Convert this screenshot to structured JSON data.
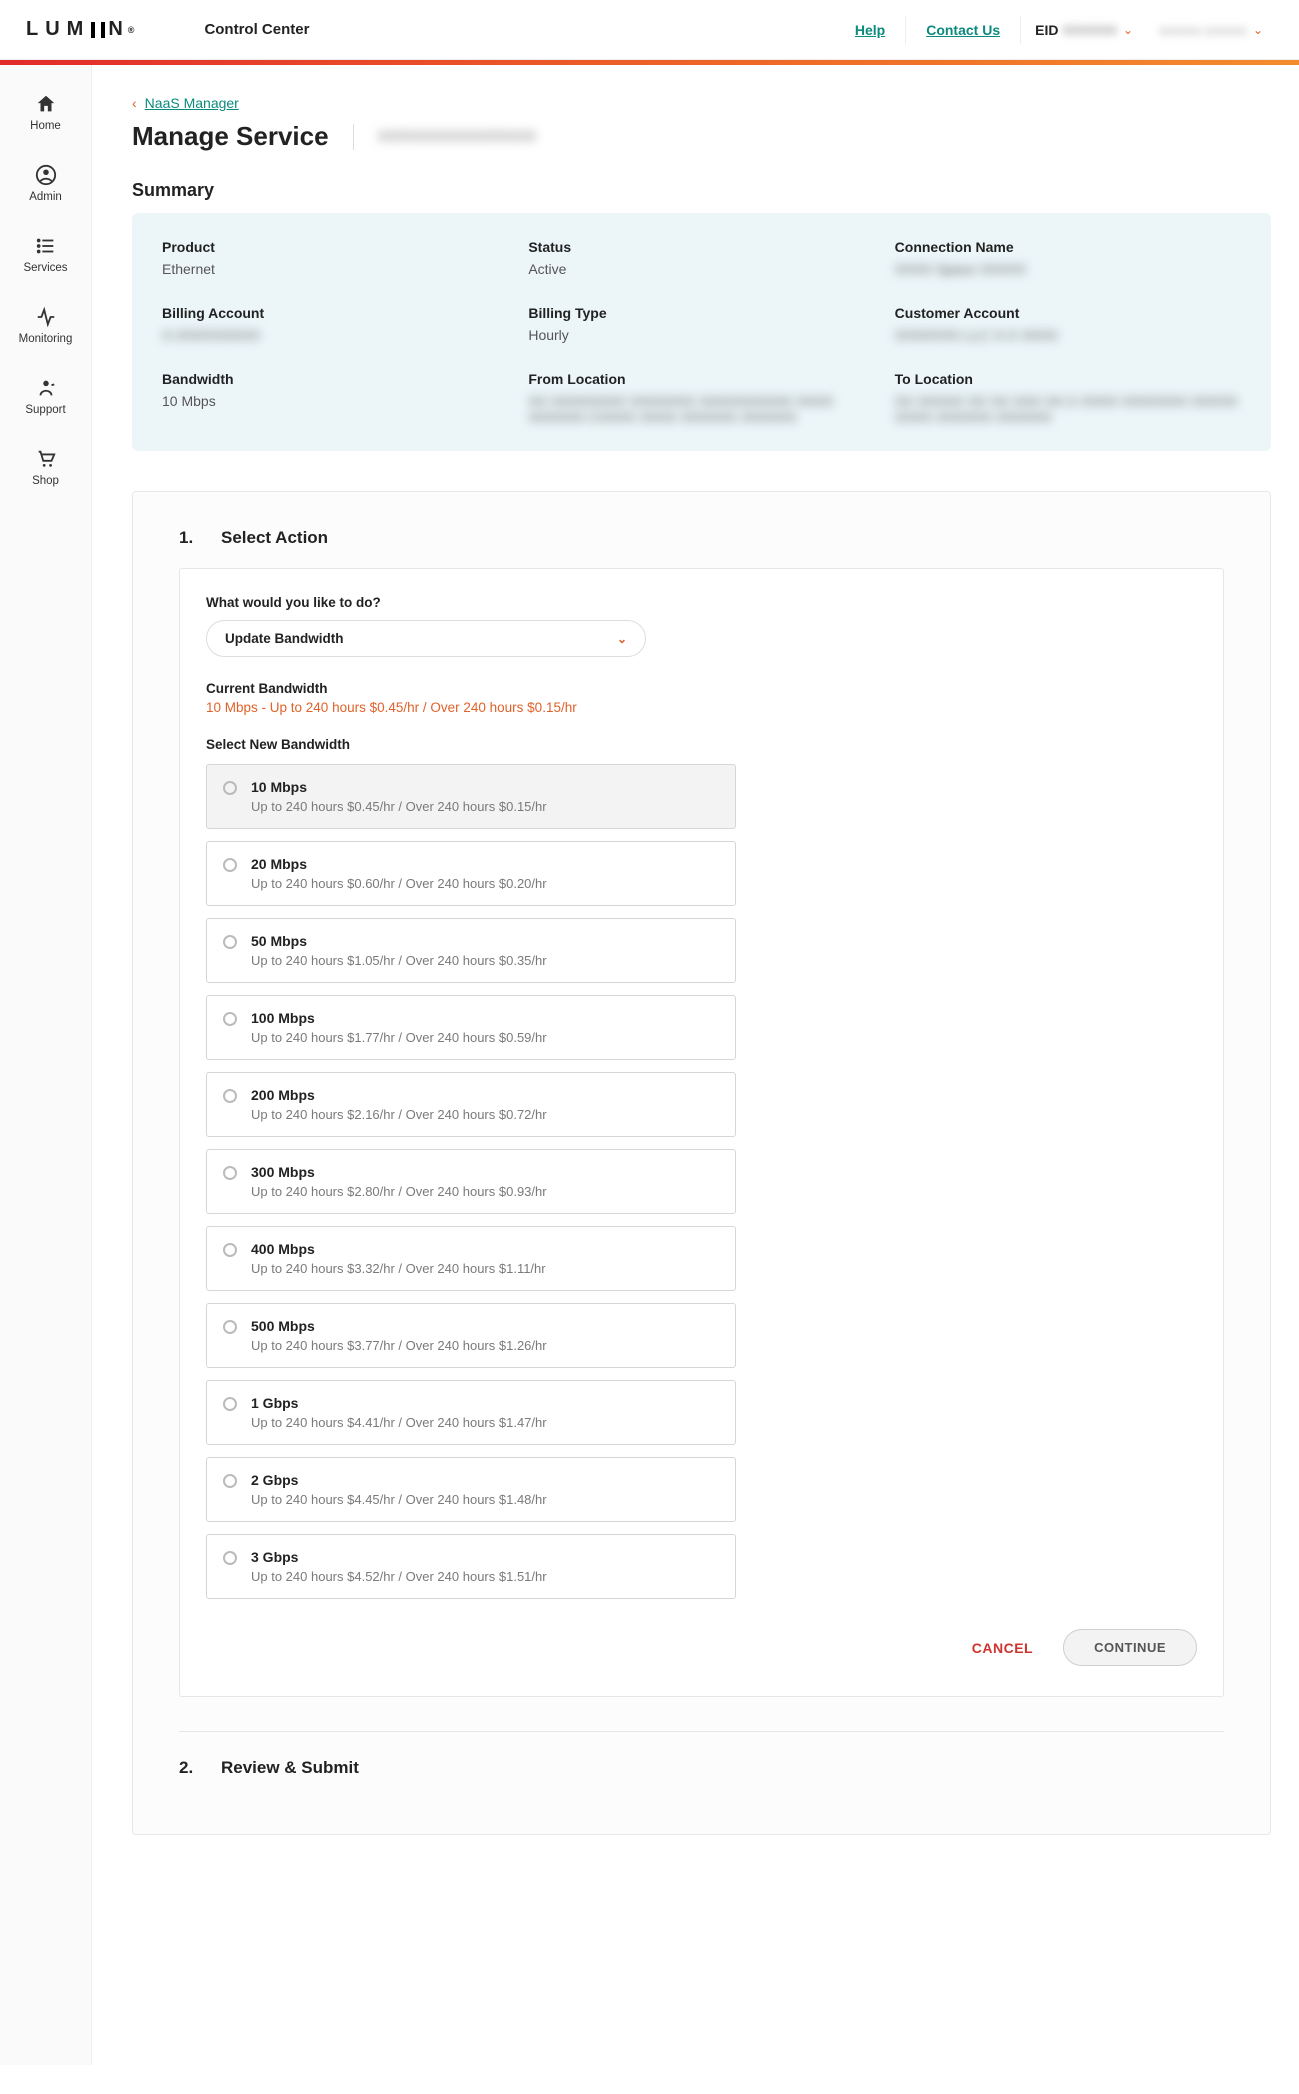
{
  "header": {
    "logo_text": "LUMEN",
    "app_title": "Control Center",
    "help": "Help",
    "contact": "Contact Us",
    "eid_label": "EID",
    "eid_value": "0000000",
    "user_text": "xxxxxx.xxxxxx"
  },
  "sidebar": {
    "items": [
      {
        "label": "Home"
      },
      {
        "label": "Admin"
      },
      {
        "label": "Services"
      },
      {
        "label": "Monitoring"
      },
      {
        "label": "Support"
      },
      {
        "label": "Shop"
      }
    ]
  },
  "breadcrumb": {
    "back_label": "NaaS Manager"
  },
  "page": {
    "title": "Manage Service",
    "service_id": "XX/XXXXXXXXX/XXXX"
  },
  "summary": {
    "heading": "Summary",
    "items": [
      {
        "label": "Product",
        "value": "Ethernet",
        "blur": false
      },
      {
        "label": "Status",
        "value": "Active",
        "blur": false
      },
      {
        "label": "Connection Name",
        "value": "XXXX Space XXXXX",
        "blur": true
      },
      {
        "label": "Billing Account",
        "value": "X-XXXXXXXXX",
        "blur": true
      },
      {
        "label": "Billing Type",
        "value": "Hourly",
        "blur": false
      },
      {
        "label": "Customer Account",
        "value": "XXXXXXX LLC X-X XXXX",
        "blur": true
      },
      {
        "label": "Bandwidth",
        "value": "10 Mbps",
        "blur": false
      },
      {
        "label": "From Location",
        "value": "XX XXXXXXXX XXXXXXX XXXXXXXXXX XXXX XXXXXX CXXXX XXXX XXXXXX XXXXXX",
        "blur": true
      },
      {
        "label": "To Location",
        "value": "XX XXXXX XX XX XXX XX.X XXXX XXXXXXX XXXXX XXXX XXXXXX XXXXXX",
        "blur": true
      }
    ]
  },
  "wizard": {
    "step1": {
      "number": "1.",
      "title": "Select Action",
      "question": "What would you like to do?",
      "action_selected": "Update Bandwidth",
      "current_label": "Current Bandwidth",
      "current_value": "10 Mbps - Up to 240 hours $0.45/hr / Over 240 hours $0.15/hr",
      "new_label": "Select New Bandwidth",
      "options": [
        {
          "title": "10 Mbps",
          "sub": "Up to 240 hours $0.45/hr / Over 240 hours $0.15/hr",
          "selected": true
        },
        {
          "title": "20 Mbps",
          "sub": "Up to 240 hours $0.60/hr / Over 240 hours $0.20/hr",
          "selected": false
        },
        {
          "title": "50 Mbps",
          "sub": "Up to 240 hours $1.05/hr / Over 240 hours $0.35/hr",
          "selected": false
        },
        {
          "title": "100 Mbps",
          "sub": "Up to 240 hours $1.77/hr / Over 240 hours $0.59/hr",
          "selected": false
        },
        {
          "title": "200 Mbps",
          "sub": "Up to 240 hours $2.16/hr / Over 240 hours $0.72/hr",
          "selected": false
        },
        {
          "title": "300 Mbps",
          "sub": "Up to 240 hours $2.80/hr / Over 240 hours $0.93/hr",
          "selected": false
        },
        {
          "title": "400 Mbps",
          "sub": "Up to 240 hours $3.32/hr / Over 240 hours $1.11/hr",
          "selected": false
        },
        {
          "title": "500 Mbps",
          "sub": "Up to 240 hours $3.77/hr / Over 240 hours $1.26/hr",
          "selected": false
        },
        {
          "title": "1 Gbps",
          "sub": "Up to 240 hours $4.41/hr / Over 240 hours $1.47/hr",
          "selected": false
        },
        {
          "title": "2 Gbps",
          "sub": "Up to 240 hours $4.45/hr / Over 240 hours $1.48/hr",
          "selected": false
        },
        {
          "title": "3 Gbps",
          "sub": "Up to 240 hours $4.52/hr / Over 240 hours $1.51/hr",
          "selected": false
        }
      ],
      "cancel": "CANCEL",
      "continue": "CONTINUE"
    },
    "step2": {
      "number": "2.",
      "title": "Review & Submit"
    }
  }
}
